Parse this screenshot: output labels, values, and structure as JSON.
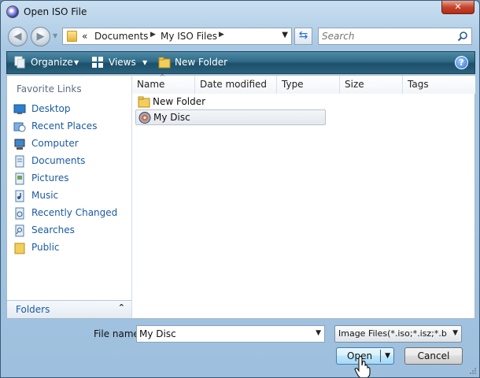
{
  "window": {
    "title": "Open ISO File",
    "close_label": "✕"
  },
  "address": {
    "crumbs": [
      "«",
      "Documents",
      "My ISO Files"
    ],
    "search_placeholder": "Search"
  },
  "toolbar": {
    "organize_label": "Organize",
    "views_label": "Views",
    "new_folder_label": "New Folder",
    "help_label": "?"
  },
  "sidebar": {
    "heading": "Favorite Links",
    "items": [
      {
        "label": "Desktop",
        "icon": "desktop-icon"
      },
      {
        "label": "Recent Places",
        "icon": "recent-places-icon"
      },
      {
        "label": "Computer",
        "icon": "computer-icon"
      },
      {
        "label": "Documents",
        "icon": "documents-icon"
      },
      {
        "label": "Pictures",
        "icon": "pictures-icon"
      },
      {
        "label": "Music",
        "icon": "music-icon"
      },
      {
        "label": "Recently Changed",
        "icon": "recently-changed-icon"
      },
      {
        "label": "Searches",
        "icon": "searches-icon"
      },
      {
        "label": "Public",
        "icon": "public-folder-icon"
      }
    ],
    "folders_label": "Folders"
  },
  "file_list": {
    "columns": [
      "Name",
      "Date modified",
      "Type",
      "Size",
      "Tags"
    ],
    "rows": [
      {
        "name": "New Folder",
        "icon": "folder-icon",
        "selected": false
      },
      {
        "name": "My Disc",
        "icon": "disc-image-icon",
        "selected": true
      }
    ]
  },
  "bottom": {
    "file_name_label": "File name:",
    "file_name_value": "My Disc",
    "filter_value": "Image Files(*.iso;*.isz;*.bin;*.c",
    "open_label": "Open",
    "cancel_label": "Cancel"
  },
  "colors": {
    "link": "#1b5ba0",
    "toolbar": "#2f6a86",
    "close": "#c6452c"
  }
}
